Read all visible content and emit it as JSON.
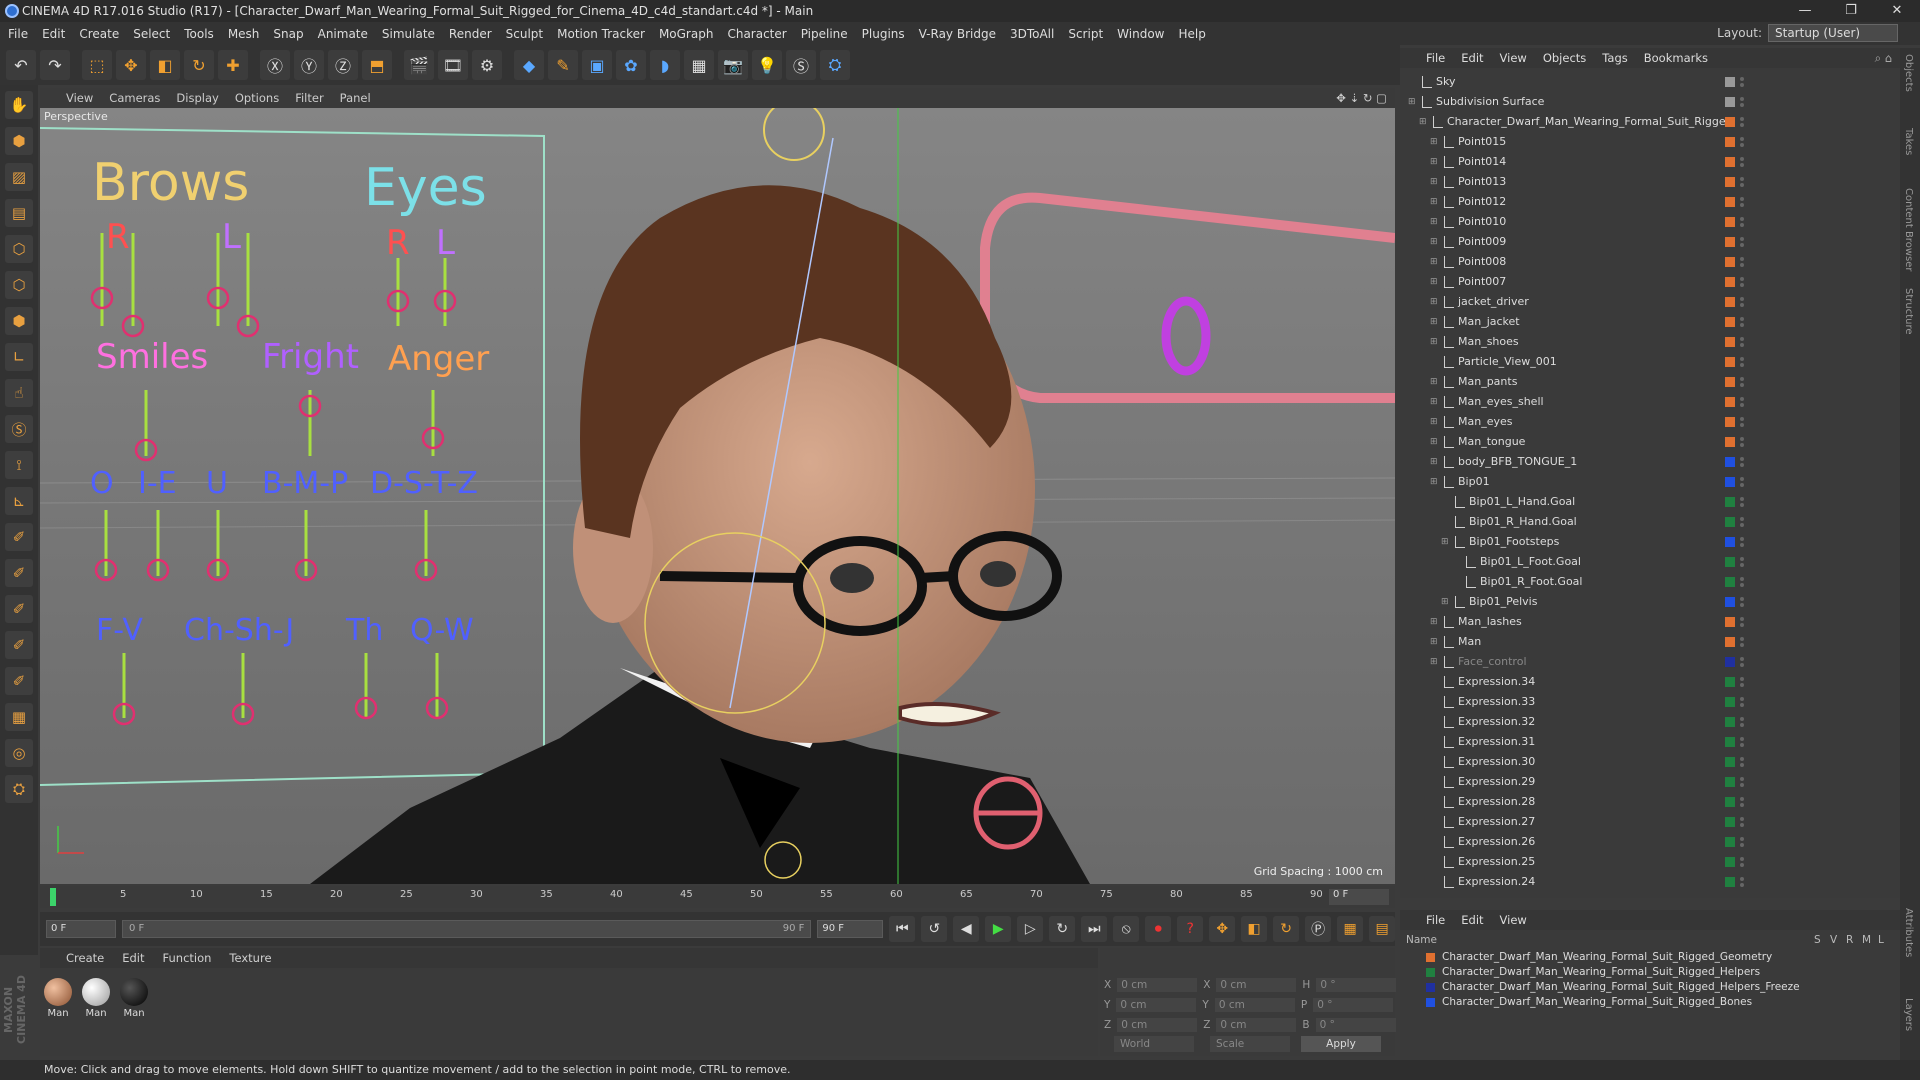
{
  "window": {
    "title": "CINEMA 4D R17.016 Studio (R17) - [Character_Dwarf_Man_Wearing_Formal_Suit_Rigged_for_Cinema_4D_c4d_standart.c4d *] - Main",
    "minimize": "—",
    "maximize": "❐",
    "close": "✕"
  },
  "menubar": [
    "File",
    "Edit",
    "Create",
    "Select",
    "Tools",
    "Mesh",
    "Snap",
    "Animate",
    "Simulate",
    "Render",
    "Sculpt",
    "Motion Tracker",
    "MoGraph",
    "Character",
    "Pipeline",
    "Plugins",
    "V-Ray Bridge",
    "3DToAll",
    "Script",
    "Window",
    "Help"
  ],
  "layout": {
    "label": "Layout:",
    "value": "Startup (User)"
  },
  "viewport": {
    "menu": [
      "View",
      "Cameras",
      "Display",
      "Options",
      "Filter",
      "Panel"
    ],
    "camera_label": "Perspective",
    "grid_spacing": "Grid Spacing : 1000 cm",
    "face_ctrl": {
      "brows": "Brows",
      "eyes": "Eyes",
      "r1": "R",
      "l1": "L",
      "r2": "R",
      "l2": "L",
      "smiles": "Smiles",
      "fright": "Fright",
      "anger": "Anger",
      "o": "O",
      "ie": "I-E",
      "u": "U",
      "bmp": "B-M-P",
      "dstz": "D-S-T-Z",
      "fv": "F-V",
      "chshj": "Ch-Sh-J",
      "th": "Th",
      "qw": "Q-W",
      "big_o": "O"
    }
  },
  "timeline": {
    "ticks": [
      "0",
      "5",
      "10",
      "15",
      "20",
      "25",
      "30",
      "35",
      "40",
      "45",
      "50",
      "55",
      "60",
      "65",
      "70",
      "75",
      "80",
      "85",
      "90"
    ],
    "current_frame": "0 F"
  },
  "transport": {
    "start": "0 F",
    "range_start": "0 F",
    "range_end": "90 F",
    "end": "90 F"
  },
  "material_manager": {
    "menu": [
      "Create",
      "Edit",
      "Function",
      "Texture"
    ],
    "materials": [
      {
        "name": "Man",
        "color": "#c08060"
      },
      {
        "name": "Man",
        "color": "#d8d0c8"
      },
      {
        "name": "Man",
        "color": "#202020"
      }
    ]
  },
  "coords": {
    "x_pos": "0 cm",
    "y_pos": "0 cm",
    "z_pos": "0 cm",
    "x_size": "0 cm",
    "y_size": "0 cm",
    "z_size": "0 cm",
    "h": "0 °",
    "p": "0 °",
    "b": "0 °",
    "lbl_x": "X",
    "lbl_y": "Y",
    "lbl_z": "Z",
    "lbl_x2": "X",
    "lbl_y2": "Y",
    "lbl_z2": "Z",
    "lbl_h": "H",
    "lbl_p": "P",
    "lbl_b": "B",
    "mode": "World",
    "scale": "Scale",
    "apply": "Apply"
  },
  "object_manager": {
    "menu": [
      "File",
      "Edit",
      "View",
      "Objects",
      "Tags",
      "Bookmarks"
    ],
    "rows": [
      {
        "name": "Sky",
        "layer": "#999999"
      },
      {
        "name": "Subdivision Surface",
        "layer": "#999999"
      },
      {
        "name": "Character_Dwarf_Man_Wearing_Formal_Suit_Rigged",
        "layer": "#e07030"
      },
      {
        "name": "Point015",
        "layer": "#e07030"
      },
      {
        "name": "Point014",
        "layer": "#e07030"
      },
      {
        "name": "Point013",
        "layer": "#e07030"
      },
      {
        "name": "Point012",
        "layer": "#e07030"
      },
      {
        "name": "Point010",
        "layer": "#e07030"
      },
      {
        "name": "Point009",
        "layer": "#e07030"
      },
      {
        "name": "Point008",
        "layer": "#e07030"
      },
      {
        "name": "Point007",
        "layer": "#e07030"
      },
      {
        "name": "jacket_driver",
        "layer": "#e07030"
      },
      {
        "name": "Man_jacket",
        "layer": "#e07030"
      },
      {
        "name": "Man_shoes",
        "layer": "#e07030"
      },
      {
        "name": "Particle_View_001",
        "layer": "#e07030"
      },
      {
        "name": "Man_pants",
        "layer": "#e07030"
      },
      {
        "name": "Man_eyes_shell",
        "layer": "#e07030"
      },
      {
        "name": "Man_eyes",
        "layer": "#e07030"
      },
      {
        "name": "Man_tongue",
        "layer": "#e07030"
      },
      {
        "name": "body_BFB_TONGUE_1",
        "layer": "#2050e0"
      },
      {
        "name": "Bip01",
        "layer": "#2050e0"
      },
      {
        "name": "Bip01_L_Hand.Goal",
        "layer": "#208040"
      },
      {
        "name": "Bip01_R_Hand.Goal",
        "layer": "#208040"
      },
      {
        "name": "Bip01_Footsteps",
        "layer": "#2050e0"
      },
      {
        "name": "Bip01_L_Foot.Goal",
        "layer": "#208040"
      },
      {
        "name": "Bip01_R_Foot.Goal",
        "layer": "#208040"
      },
      {
        "name": "Bip01_Pelvis",
        "layer": "#2050e0"
      },
      {
        "name": "Man_lashes",
        "layer": "#e07030"
      },
      {
        "name": "Man",
        "layer": "#e07030"
      },
      {
        "name": "Face_control",
        "layer": "#2030a0"
      },
      {
        "name": "Expression.34",
        "layer": "#208040"
      },
      {
        "name": "Expression.33",
        "layer": "#208040"
      },
      {
        "name": "Expression.32",
        "layer": "#208040"
      },
      {
        "name": "Expression.31",
        "layer": "#208040"
      },
      {
        "name": "Expression.30",
        "layer": "#208040"
      },
      {
        "name": "Expression.29",
        "layer": "#208040"
      },
      {
        "name": "Expression.28",
        "layer": "#208040"
      },
      {
        "name": "Expression.27",
        "layer": "#208040"
      },
      {
        "name": "Expression.26",
        "layer": "#208040"
      },
      {
        "name": "Expression.25",
        "layer": "#208040"
      },
      {
        "name": "Expression.24",
        "layer": "#208040"
      }
    ]
  },
  "layer_manager": {
    "menu": [
      "File",
      "Edit",
      "View"
    ],
    "headers": {
      "name": "Name",
      "s": "S",
      "v": "V",
      "r": "R",
      "m": "M",
      "l": "L"
    },
    "layers": [
      {
        "name": "Character_Dwarf_Man_Wearing_Formal_Suit_Rigged_Geometry",
        "color": "#e07030"
      },
      {
        "name": "Character_Dwarf_Man_Wearing_Formal_Suit_Rigged_Helpers",
        "color": "#208040"
      },
      {
        "name": "Character_Dwarf_Man_Wearing_Formal_Suit_Rigged_Helpers_Freeze",
        "color": "#2030a0"
      },
      {
        "name": "Character_Dwarf_Man_Wearing_Formal_Suit_Rigged_Bones",
        "color": "#2050e0"
      }
    ]
  },
  "right_strip": [
    "Objects",
    "Takes",
    "Content Browser",
    "Structure",
    "Attributes",
    "Layers"
  ],
  "status": "Move: Click and drag to move elements. Hold down SHIFT to quantize movement / add to the selection in point mode, CTRL to remove."
}
